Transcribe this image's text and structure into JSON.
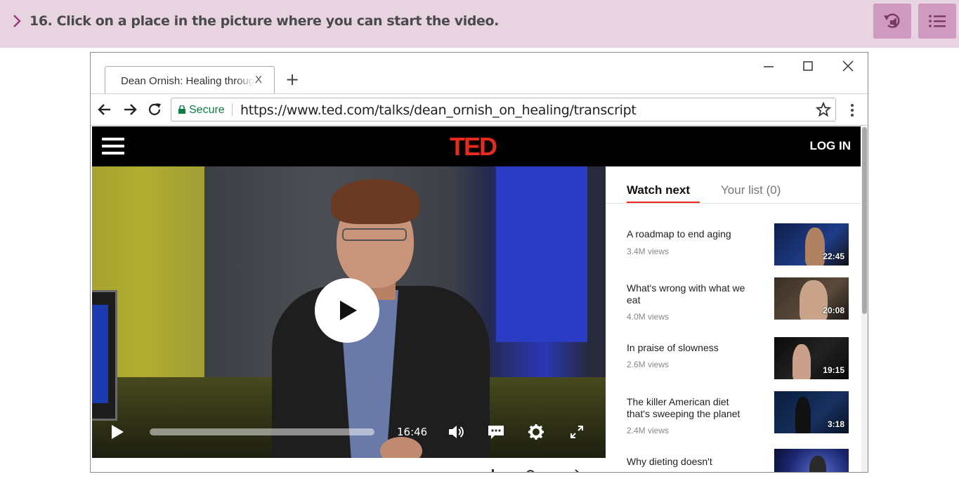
{
  "question": {
    "text": "16. Click on a place in the picture where you can start the video.",
    "audio_icon": "replay-audio-icon",
    "menu_icon": "list-menu-icon"
  },
  "browser": {
    "tab_title": "Dean Ornish: Healing through diet",
    "tab_close": "X",
    "new_tab": "+",
    "secure_label": "Secure",
    "url": "https://www.ted.com/talks/dean_ornish_on_healing/transcript"
  },
  "ted": {
    "logo": "TED",
    "login": "LOG IN",
    "video": {
      "time": "16:46"
    },
    "sidebar": {
      "tab_watch_next": "Watch next",
      "tab_your_list": "Your list (0)",
      "items": [
        {
          "title": "A roadmap to end aging",
          "views": "3.4M views",
          "duration": "22:45"
        },
        {
          "title": "What's wrong with what we eat",
          "views": "4.0M views",
          "duration": "20:08"
        },
        {
          "title": "In praise of slowness",
          "views": "2.6M views",
          "duration": "19:15"
        },
        {
          "title": "The killer American diet that's sweeping the planet",
          "views": "2.4M views",
          "duration": "3:18"
        },
        {
          "title": "Why dieting doesn't",
          "views": "",
          "duration": ""
        }
      ]
    }
  },
  "colors": {
    "header_bg": "#e8d3e1",
    "header_btn": "#cf99c0",
    "ted_red": "#e62b1e",
    "secure_green": "#0b8043"
  }
}
